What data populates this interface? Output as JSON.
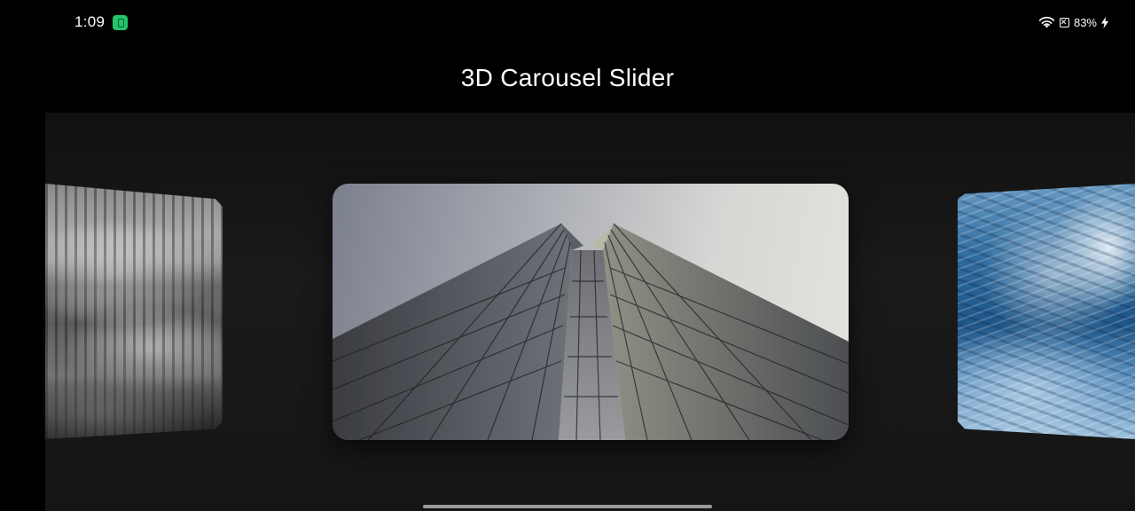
{
  "status_bar": {
    "time": "1:09",
    "battery": "83%",
    "icons": [
      "app-notification-icon",
      "wifi-icon",
      "no-sim-icon",
      "charging-bolt-icon"
    ]
  },
  "app_bar": {
    "title": "3D Carousel Slider"
  },
  "carousel": {
    "slides": [
      {
        "name": "foggy-forest",
        "position": "left"
      },
      {
        "name": "skyscraper",
        "position": "center"
      },
      {
        "name": "ocean-wave",
        "position": "right"
      }
    ]
  },
  "colors": {
    "background": "#000000",
    "carousel_bg": "#1a1a1a",
    "app_icon": "#21c56b",
    "text": "#ffffff"
  }
}
